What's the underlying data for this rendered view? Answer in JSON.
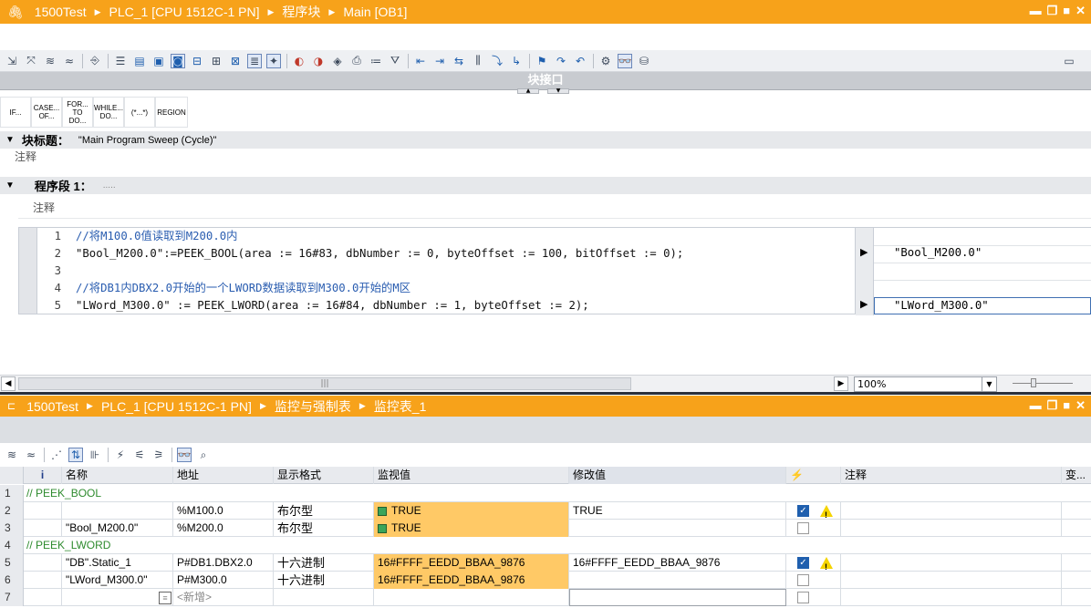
{
  "editor": {
    "breadcrumb": [
      "1500Test",
      "PLC_1 [CPU 1512C-1 PN]",
      "程序块",
      "Main [OB1]"
    ],
    "block_interface_label": "块接口",
    "instructions": [
      "IF...",
      "CASE... OF...",
      "FOR... TO DO...",
      "WHILE... DO...",
      "(*...*)",
      "REGION"
    ],
    "block_title_label": "块标题：",
    "block_title_value": "\"Main Program Sweep (Cycle)\"",
    "comment_label": "注释",
    "network_label": "程序段 1：",
    "network_title": ".....",
    "network_comment": "注释",
    "code_lines": [
      {
        "num": "1",
        "text": "//将M100.0值读取到M200.0内",
        "type": "comment"
      },
      {
        "num": "2",
        "text": "\"Bool_M200.0\":=PEEK_BOOL(area := 16#83, dbNumber := 0, byteOffset := 100, bitOffset := 0);",
        "type": "code"
      },
      {
        "num": "3",
        "text": "",
        "type": "code"
      },
      {
        "num": "4",
        "text": "//将DB1内DBX2.0开始的一个LWORD数据读取到M300.0开始的M区",
        "type": "comment"
      },
      {
        "num": "5",
        "text": "\"LWord_M300.0\" := PEEK_LWORD(area := 16#84, dbNumber := 1, byteOffset := 2);",
        "type": "code"
      }
    ],
    "monitor_values": [
      "\"Bool_M200.0\"",
      "\"LWord_M300.0\""
    ],
    "zoom": "100%"
  },
  "watch": {
    "breadcrumb": [
      "1500Test",
      "PLC_1 [CPU 1512C-1 PN]",
      "监控与强制表",
      "监控表_1"
    ],
    "columns": {
      "info": "i",
      "name": "名称",
      "address": "地址",
      "format": "显示格式",
      "monitor": "监视值",
      "modify": "修改值",
      "comment": "注释",
      "more": "变..."
    },
    "rows": [
      {
        "num": "1",
        "group": "// PEEK_BOOL"
      },
      {
        "num": "2",
        "name": "",
        "address": "%M100.0",
        "format": "布尔型",
        "monitor": "TRUE",
        "modify": "TRUE",
        "checked": true,
        "warn": true
      },
      {
        "num": "3",
        "name": "\"Bool_M200.0\"",
        "address": "%M200.0",
        "format": "布尔型",
        "monitor": "TRUE",
        "modify": "",
        "checked": false,
        "warn": false
      },
      {
        "num": "4",
        "group": "// PEEK_LWORD"
      },
      {
        "num": "5",
        "name": "\"DB\".Static_1",
        "address": "P#DB1.DBX2.0",
        "format": "十六进制",
        "monitor": "16#FFFF_EEDD_BBAA_9876",
        "modify": "16#FFFF_EEDD_BBAA_9876",
        "checked": true,
        "warn": true
      },
      {
        "num": "6",
        "name": "\"LWord_M300.0\"",
        "address": "P#M300.0",
        "format": "十六进制",
        "monitor": "16#FFFF_EEDD_BBAA_9876",
        "modify": "",
        "checked": false,
        "warn": false
      },
      {
        "num": "7",
        "new_label": "<新增>"
      }
    ]
  },
  "colors": {
    "title_orange": "#f7a21a",
    "monitor_orange": "#ffc966",
    "bool_green": "#3aa55a",
    "comment_blue": "#2a5db0"
  }
}
